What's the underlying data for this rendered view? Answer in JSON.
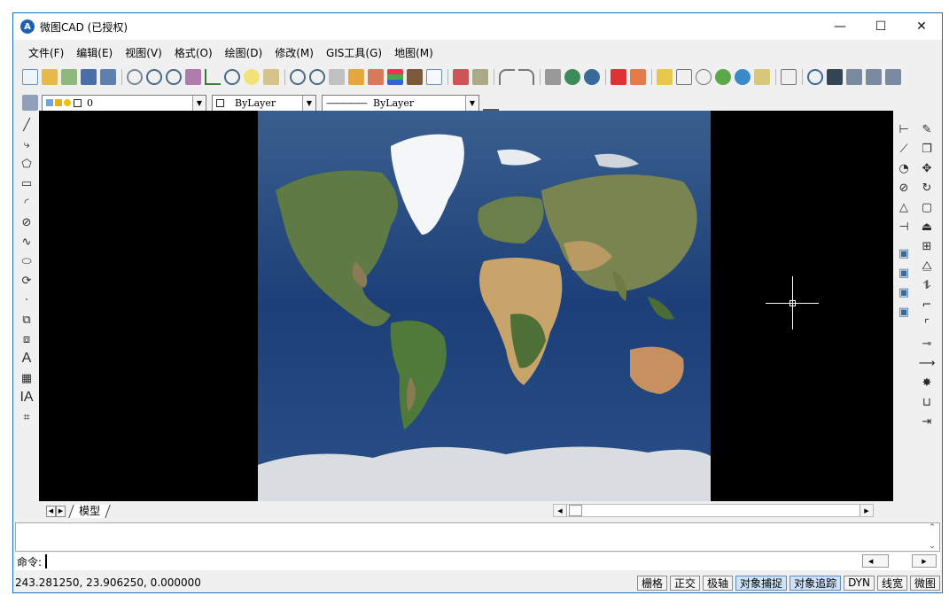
{
  "window": {
    "title": "微图CAD (已授权)",
    "app_icon": "cad-app-icon",
    "controls": {
      "minimize": "—",
      "maximize": "☐",
      "close": "✕"
    }
  },
  "menu": [
    "文件(F)",
    "编辑(E)",
    "视图(V)",
    "格式(O)",
    "绘图(D)",
    "修改(M)",
    "GIS工具(G)",
    "地图(M)"
  ],
  "properties": {
    "layer_value": "0",
    "color_value": "ByLayer",
    "linetype_value": "ByLayer",
    "linetype_prefix": "—————"
  },
  "left_tools": {
    "text_tool": "A",
    "mtext_tool": "IA"
  },
  "canvas": {
    "background": "#000000",
    "map_ocean": "#1b3d73"
  },
  "tabs": {
    "model_tab": "模型"
  },
  "command": {
    "prompt": "命令:",
    "input_value": ""
  },
  "status": {
    "coordinates": "243.281250,  23.906250,  0.000000",
    "buttons": [
      {
        "label": "栅格",
        "on": false
      },
      {
        "label": "正交",
        "on": false
      },
      {
        "label": "极轴",
        "on": false
      },
      {
        "label": "对象捕捉",
        "on": true
      },
      {
        "label": "对象追踪",
        "on": true
      },
      {
        "label": "DYN",
        "on": false
      },
      {
        "label": "线宽",
        "on": false
      },
      {
        "label": "微图",
        "on": false
      }
    ]
  }
}
